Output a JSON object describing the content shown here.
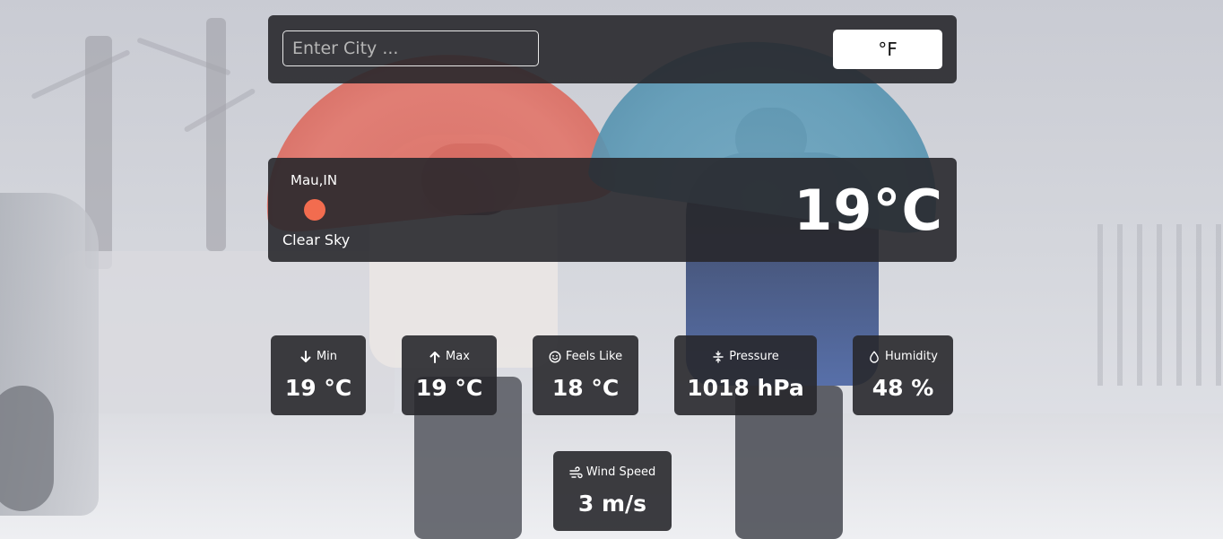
{
  "search": {
    "placeholder": "Enter City ...",
    "value": "",
    "unit_toggle_label": "°F"
  },
  "current": {
    "location": "Mau,IN",
    "condition": "Clear Sky",
    "temperature": "19°C",
    "icon": "sun-icon",
    "icon_color": "#f26c4f"
  },
  "stats": {
    "min": {
      "label": "Min",
      "value": "19 °C",
      "icon": "arrow-down-icon"
    },
    "max": {
      "label": "Max",
      "value": "19 °C",
      "icon": "arrow-up-icon"
    },
    "feels_like": {
      "label": "Feels Like",
      "value": "18 °C",
      "icon": "smile-icon"
    },
    "pressure": {
      "label": "Pressure",
      "value": "1018 hPa",
      "icon": "compress-icon"
    },
    "humidity": {
      "label": "Humidity",
      "value": "48 %",
      "icon": "droplet-icon"
    },
    "wind": {
      "label": "Wind Speed",
      "value": "3 m/s",
      "icon": "wind-icon"
    }
  },
  "theme": {
    "panel_color": "#28282c",
    "button_color": "#ffffff"
  }
}
